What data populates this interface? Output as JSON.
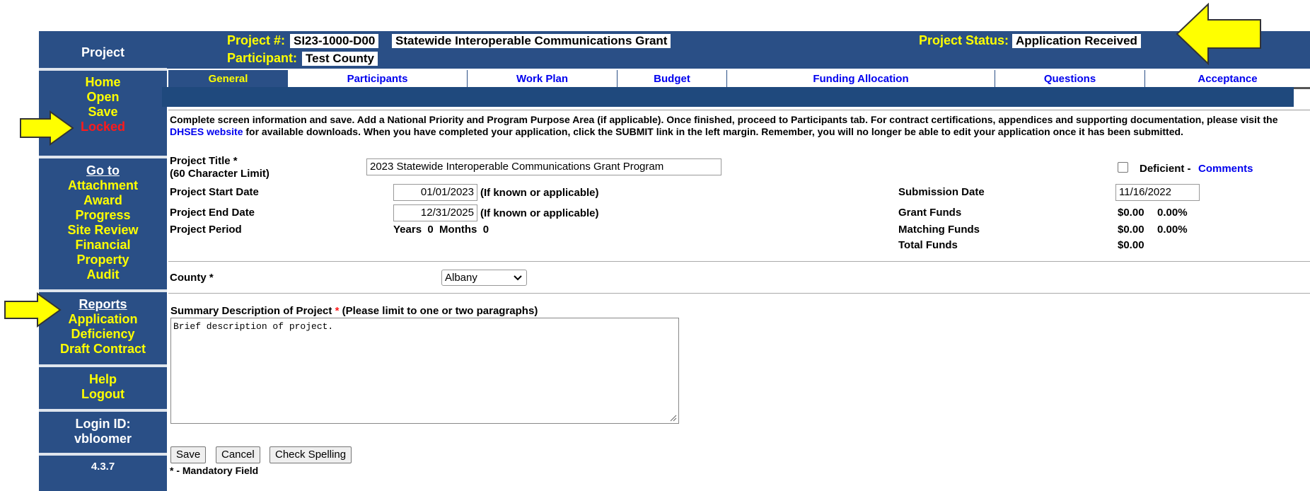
{
  "sidebar": {
    "project": "Project",
    "nav1": [
      "Home",
      "Open",
      "Save"
    ],
    "locked": "Locked",
    "goto_label": "Go to",
    "goto_items": [
      "Attachment",
      "Award",
      "Progress",
      "Site Review",
      "Financial",
      "Property",
      "Audit"
    ],
    "reports_label": "Reports",
    "reports_items": [
      "Application",
      "Deficiency",
      "Draft Contract"
    ],
    "help": "Help",
    "logout": "Logout",
    "login_label": "Login ID:",
    "login_id": "vbloomer",
    "version": "4.3.7"
  },
  "header": {
    "project_num_label": "Project #:",
    "project_num": "SI23-1000-D00",
    "project_name": "Statewide Interoperable Communications Grant",
    "participant_label": "Participant:",
    "participant": "Test County",
    "status_label": "Project Status:",
    "status": "Application Received"
  },
  "tabs": [
    "General",
    "Participants",
    "Work Plan",
    "Budget",
    "Funding Allocation",
    "Questions",
    "Acceptance"
  ],
  "intro": {
    "text1": "Complete screen information and save. Add a National Priority and Program Purpose Area (if applicable). Once finished, proceed to Participants tab. For contract certifications, appendices and supporting documentation, please visit the ",
    "link": "DHSES website",
    "text2": " for available downloads. When you have completed your application, click the SUBMIT link in the left margin. Remember, you will no longer be able to edit your application once it has been submitted."
  },
  "form": {
    "title_label": "Project Title *",
    "title_limit": "(60 Character Limit)",
    "title_value": "2023 Statewide Interoperable Communications Grant Program",
    "deficient_label": "Deficient -",
    "comments_link": "Comments",
    "start_label": "Project Start Date",
    "start_value": "01/01/2023",
    "if_known": "(If known or applicable)",
    "end_label": "Project End Date",
    "end_value": "12/31/2025",
    "period_label": "Project Period",
    "period_value": "Years  0  Months  0",
    "submission_label": "Submission Date",
    "submission_value": "11/16/2022",
    "grant_label": "Grant Funds",
    "grant_value": "$0.00",
    "grant_pct": "0.00%",
    "matching_label": "Matching Funds",
    "matching_value": "$0.00",
    "matching_pct": "0.00%",
    "total_label": "Total Funds",
    "total_value": "$0.00",
    "county_label": "County *",
    "county_value": "Albany",
    "summary_label": "Summary Description of Project",
    "summary_star": "*",
    "summary_hint": "(Please limit to one or two paragraphs)",
    "summary_value": "Brief description of project.",
    "save_btn": "Save",
    "cancel_btn": "Cancel",
    "spell_btn": "Check Spelling",
    "mandatory": "* - Mandatory Field"
  },
  "colors": {
    "nav_bg": "#2a4f86",
    "accent_yellow": "#ffff00",
    "locked_red": "#ff1a1a",
    "link_blue": "#0000ee"
  }
}
